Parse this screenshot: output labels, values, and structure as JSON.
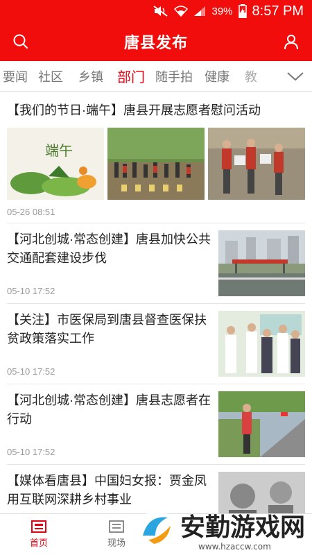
{
  "status": {
    "battery": "39%",
    "time": "8:57 PM"
  },
  "header": {
    "title": "唐县发布"
  },
  "tabs": [
    "要闻",
    "社区",
    "乡镇",
    "部门",
    "随手拍",
    "健康",
    "教"
  ],
  "active_tab": "部门",
  "articles": [
    {
      "title": "【我们的节日·端午】唐县开展志愿者慰问活动",
      "time": "05-26 08:51",
      "image_text": "端午"
    },
    {
      "title": "【河北创城·常态创建】唐县加快公共交通配套建设步伐",
      "time": "05-10 17:52"
    },
    {
      "title": "【关注】市医保局到唐县督查医保扶贫政策落实工作",
      "time": "05-10 17:52"
    },
    {
      "title": "【河北创城·常态创建】唐县志愿者在行动",
      "time": "05-10 17:52"
    },
    {
      "title": "【媒体看唐县】中国妇女报：贾金凤用互联网深耕乡村事业"
    }
  ],
  "bottom_nav": {
    "home": "首页",
    "live": "现场"
  },
  "watermark": {
    "text": "安勤游戏网",
    "url": "www.hzaccw.com"
  },
  "colors": {
    "brand_red": "#f20d0d",
    "active_red": "#e60012"
  }
}
